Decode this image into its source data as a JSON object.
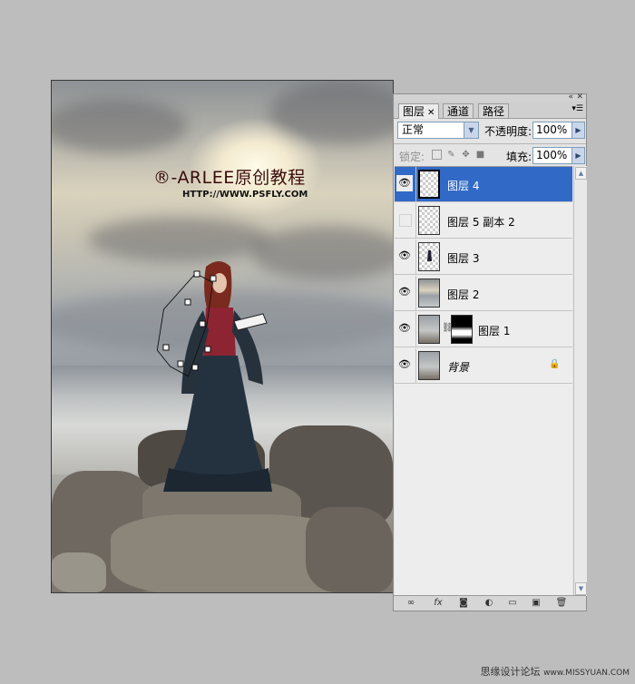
{
  "canvas": {
    "watermark_main": "®-ARLEE原创教程",
    "watermark_url": "HTTP://WWW.PSFLY.COM"
  },
  "panel": {
    "tabs": [
      {
        "label": "图层",
        "active": true
      },
      {
        "label": "通道",
        "active": false
      },
      {
        "label": "路径",
        "active": false
      }
    ],
    "blend_mode": "正常",
    "opacity_label": "不透明度:",
    "opacity_value": "100%",
    "lock_label": "锁定:",
    "fill_label": "填充:",
    "fill_value": "100%",
    "layers": [
      {
        "name": "图层 4",
        "visible": true,
        "selected": true,
        "thumb": "transparent"
      },
      {
        "name": "图层 5 副本 2",
        "visible": false,
        "selected": false,
        "thumb": "transparent"
      },
      {
        "name": "图层 3",
        "visible": true,
        "selected": false,
        "thumb": "figure"
      },
      {
        "name": "图层 2",
        "visible": true,
        "selected": false,
        "thumb": "sky"
      },
      {
        "name": "图层 1",
        "visible": true,
        "selected": false,
        "thumb": "sea",
        "has_mask": true
      },
      {
        "name": "背景",
        "visible": true,
        "selected": false,
        "thumb": "background",
        "locked": true
      }
    ],
    "bottom_icons": [
      "link-layers-icon",
      "fx-icon",
      "layer-mask-icon",
      "adjustment-layer-icon",
      "group-folder-icon",
      "new-layer-icon",
      "trash-icon"
    ]
  },
  "footer": {
    "text_cn": "思缘设计论坛",
    "text_url": "www.MISSYUAN.COM"
  },
  "colors": {
    "selection": "#3169c6",
    "panel_bg": "#e4e4e4",
    "workspace": "#bdbdbd"
  }
}
